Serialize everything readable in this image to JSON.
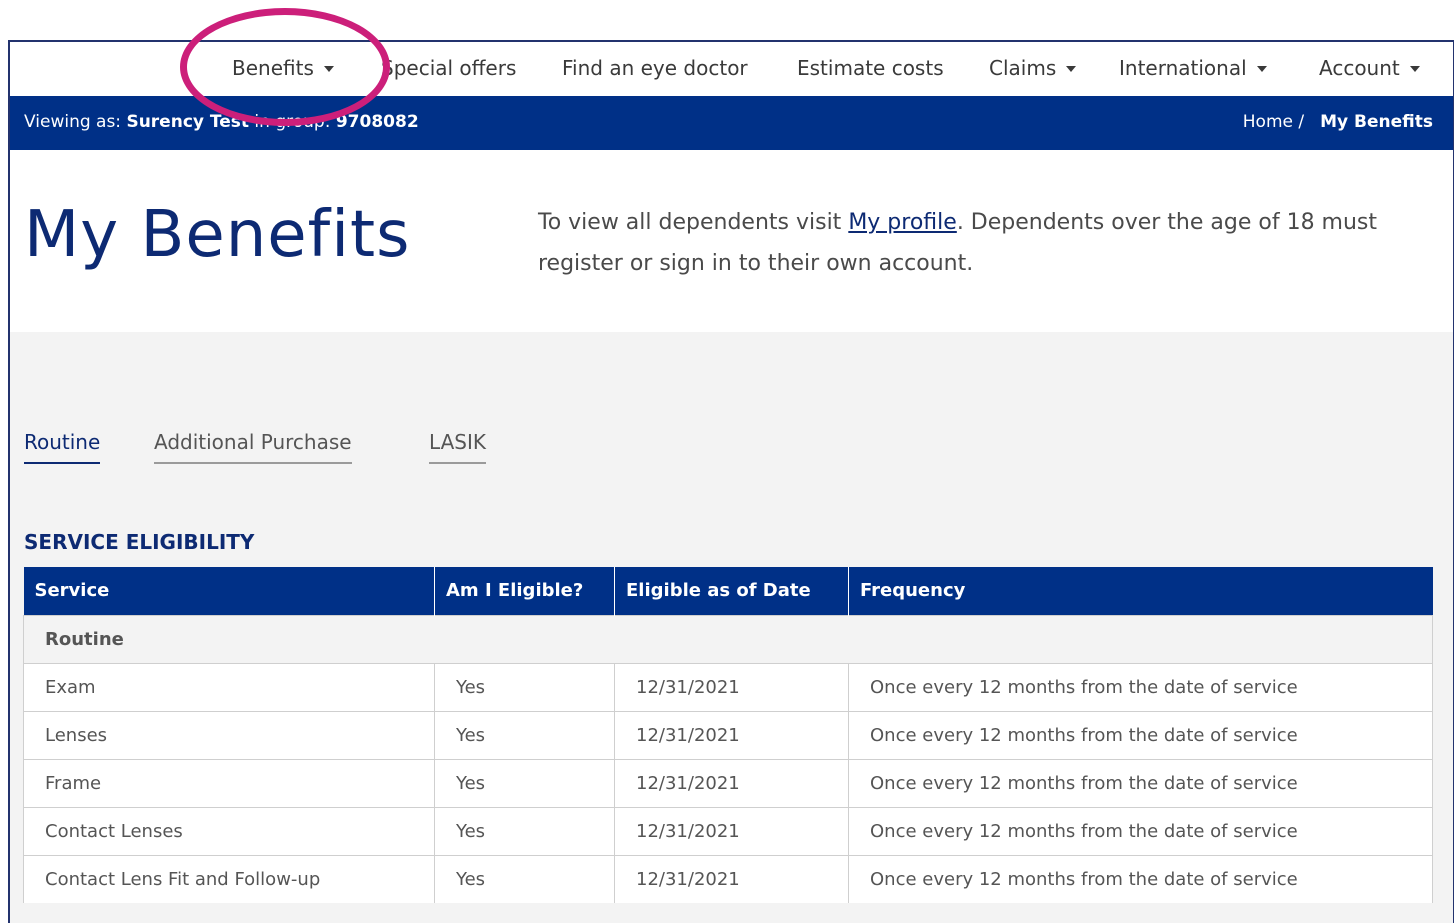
{
  "nav": {
    "items": [
      {
        "label": "Benefits",
        "dropdown": true
      },
      {
        "label": "Special offers",
        "dropdown": false
      },
      {
        "label": "Find an eye doctor",
        "dropdown": false
      },
      {
        "label": "Estimate costs",
        "dropdown": false
      },
      {
        "label": "Claims",
        "dropdown": true
      },
      {
        "label": "International",
        "dropdown": true
      },
      {
        "label": "Account",
        "dropdown": true
      }
    ]
  },
  "bar": {
    "viewing_label": "Viewing as:",
    "viewing_name": "Surency Test",
    "group_label": "in group:",
    "group_id": "9708082",
    "breadcrumb_home": "Home /",
    "breadcrumb_current": "My Benefits"
  },
  "hero": {
    "title": "My Benefits",
    "text_before": "To view all dependents visit ",
    "link": "My profile",
    "text_after": ". Dependents over the age of 18 must register or sign in to their own account."
  },
  "tabs": [
    "Routine",
    "Additional Purchase",
    "LASIK"
  ],
  "section_title": "SERVICE ELIGIBILITY",
  "table": {
    "headers": [
      "Service",
      "Am I Eligible?",
      "Eligible as of Date",
      "Frequency"
    ],
    "group": "Routine",
    "rows": [
      [
        "Exam",
        "Yes",
        "12/31/2021",
        "Once every 12 months from the date of service"
      ],
      [
        "Lenses",
        "Yes",
        "12/31/2021",
        "Once every 12 months from the date of service"
      ],
      [
        "Frame",
        "Yes",
        "12/31/2021",
        "Once every 12 months from the date of service"
      ],
      [
        "Contact Lenses",
        "Yes",
        "12/31/2021",
        "Once every 12 months from the date of service"
      ],
      [
        "Contact Lens Fit and Follow-up",
        "Yes",
        "12/31/2021",
        "Once every 12 months from the date of service"
      ]
    ]
  },
  "colors": {
    "brand_blue": "#003087",
    "annotation": "#cc1f7a"
  }
}
